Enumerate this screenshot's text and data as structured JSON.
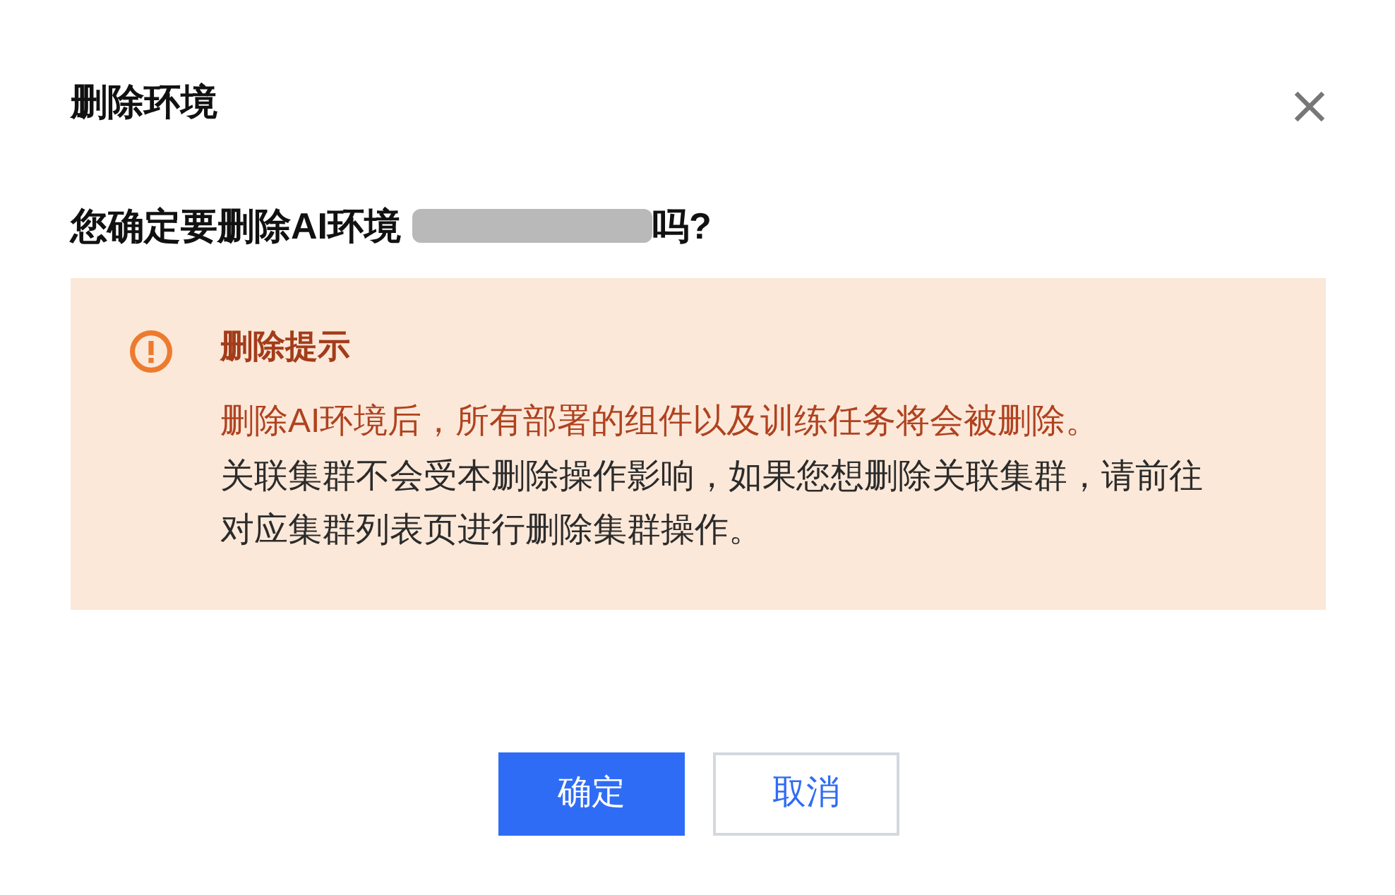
{
  "dialog": {
    "title": "删除环境",
    "question": {
      "before": "您确定要删除AI环境",
      "after": "吗?"
    },
    "alert": {
      "title": "删除提示",
      "paragraphs": [
        {
          "text": "删除AI环境后，所有部署的组件以及训练任务将会被删除。",
          "highlighted": true
        },
        {
          "text": "关联集群不会受本删除操作影响，如果您想删除关联集群，请前往对应集群列表页进行删除集群操作。",
          "highlighted": false
        }
      ]
    },
    "buttons": [
      {
        "label": "确定",
        "kind": "primary"
      },
      {
        "label": "取消",
        "kind": "secondary"
      }
    ]
  }
}
